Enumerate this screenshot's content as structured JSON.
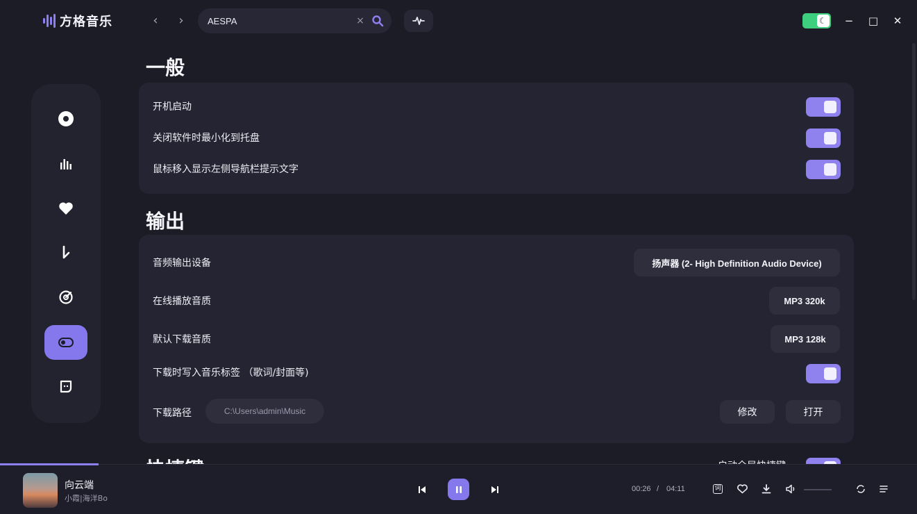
{
  "app": {
    "name": "方格音乐"
  },
  "search": {
    "value": "AESPA",
    "clear": "×"
  },
  "window": {
    "minimize": "−",
    "maximize": "□",
    "close": "✕",
    "theme_icon": "moon-icon"
  },
  "sidebar": {
    "items": [
      {
        "icon": "disc-icon"
      },
      {
        "icon": "chart-bars-icon"
      },
      {
        "icon": "heart-icon"
      },
      {
        "icon": "download-icon"
      },
      {
        "icon": "radar-icon"
      },
      {
        "icon": "toggle-settings-icon",
        "active": true
      },
      {
        "icon": "chat-icon"
      }
    ]
  },
  "general": {
    "title": "一般",
    "rows": [
      {
        "label": "开机启动",
        "on": true
      },
      {
        "label": "关闭软件时最小化到托盘",
        "on": true
      },
      {
        "label": "鼠标移入显示左侧导航栏提示文字",
        "on": true
      }
    ]
  },
  "output": {
    "title": "输出",
    "device_label": "音频输出设备",
    "device_value": "扬声器 (2- High Definition Audio Device)",
    "online_quality_label": "在线播放音质",
    "online_quality_value": "MP3 320k",
    "download_quality_label": "默认下载音质",
    "download_quality_value": "MP3 128k",
    "write_tags_label": "下载时写入音乐标签 （歌词/封面等)",
    "path_label": "下载路径",
    "path_value": "C:\\Users\\admin\\Music",
    "modify_btn": "修改",
    "open_btn": "打开"
  },
  "shortcuts": {
    "title": "快捷键",
    "global_label": "启动全局快捷键"
  },
  "player": {
    "title": "向云端",
    "artist": "小霞|海洋Bo",
    "current_time": "00:26",
    "separator": "/",
    "total_time": "04:11",
    "progress_fraction": 0.1,
    "lyric_btn": "词"
  },
  "colors": {
    "accent": "#8577ec",
    "background": "#1c1c27",
    "card": "#242432",
    "theme_toggle": "#3ecf7e"
  }
}
